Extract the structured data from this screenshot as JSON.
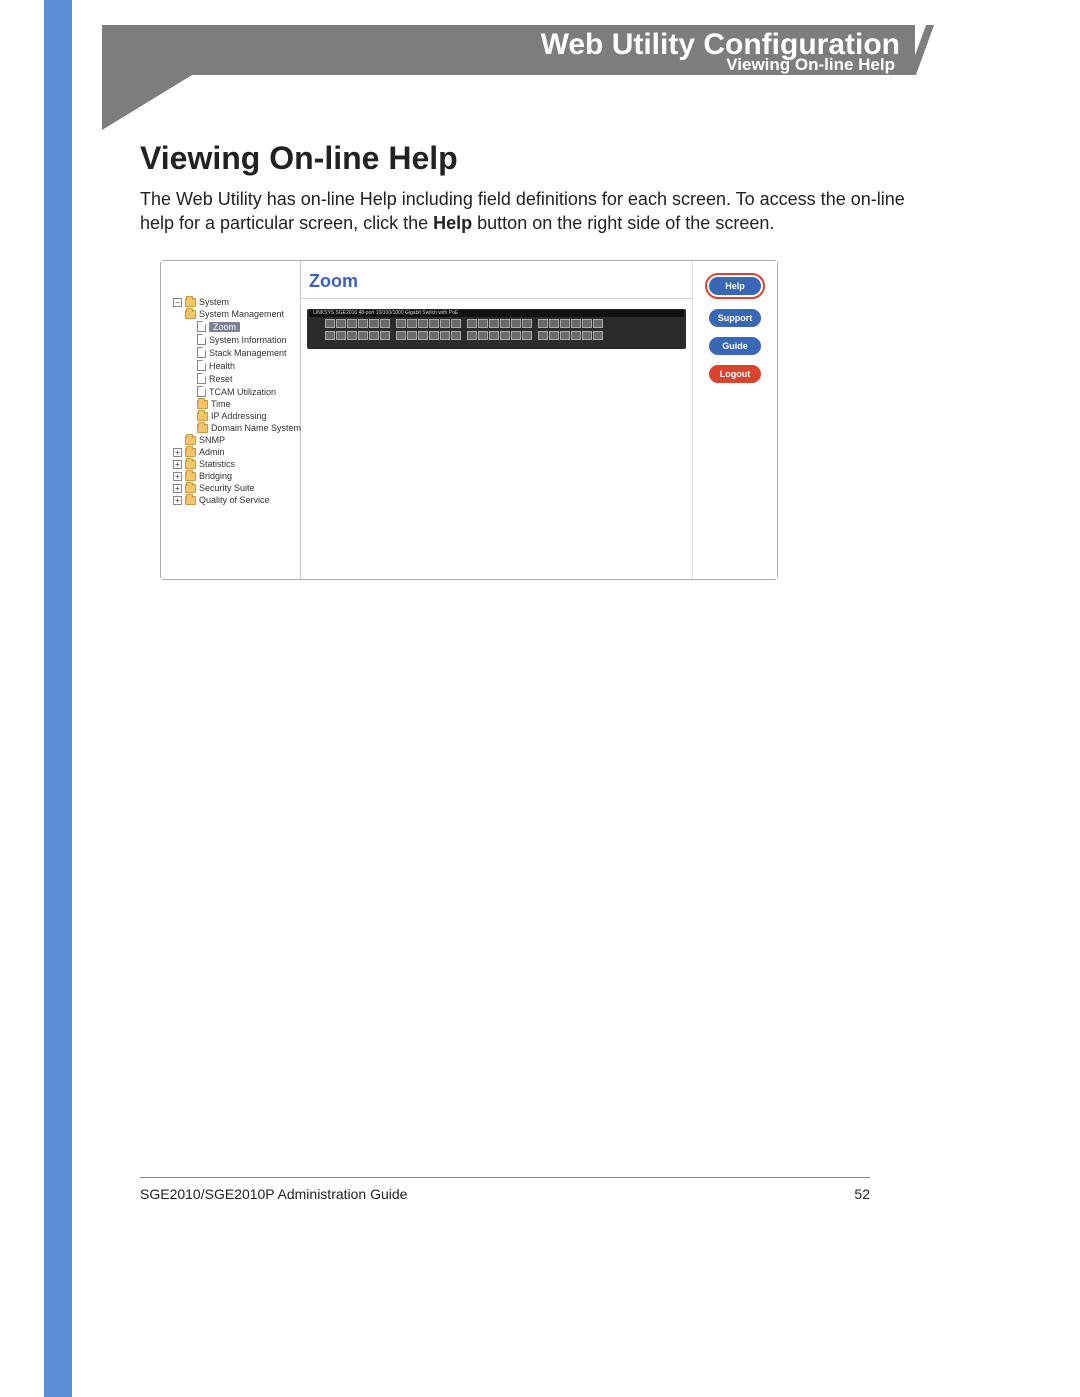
{
  "header": {
    "title": "Web Utility Configuration",
    "subtitle": "Viewing On-line Help"
  },
  "body": {
    "heading": "Viewing On-line Help",
    "paragraph_pre": "The Web Utility has on-line Help including field definitions for each screen. To access the on-line help for a particular screen, click the ",
    "paragraph_bold": "Help",
    "paragraph_post": " button on the right side of the screen."
  },
  "screenshot": {
    "main_title": "Zoom",
    "device_label": "LINKSYS  SGE2010  48-port 10/100/1000 Gigabit Switch with PoE",
    "tree": {
      "system": "System",
      "system_management": "System Management",
      "zoom": "Zoom",
      "system_information": "System Information",
      "stack_management": "Stack Management",
      "health": "Health",
      "reset": "Reset",
      "tcam": "TCAM Utilization",
      "time": "Time",
      "ip_addressing": "IP Addressing",
      "dns": "Domain Name System",
      "snmp": "SNMP",
      "admin": "Admin",
      "statistics": "Statistics",
      "bridging": "Bridging",
      "security": "Security Suite",
      "qos": "Quality of Service"
    },
    "buttons": {
      "help": "Help",
      "support": "Support",
      "guide": "Guide",
      "logout": "Logout"
    }
  },
  "footer": {
    "guide": "SGE2010/SGE2010P Administration Guide",
    "page": "52"
  }
}
